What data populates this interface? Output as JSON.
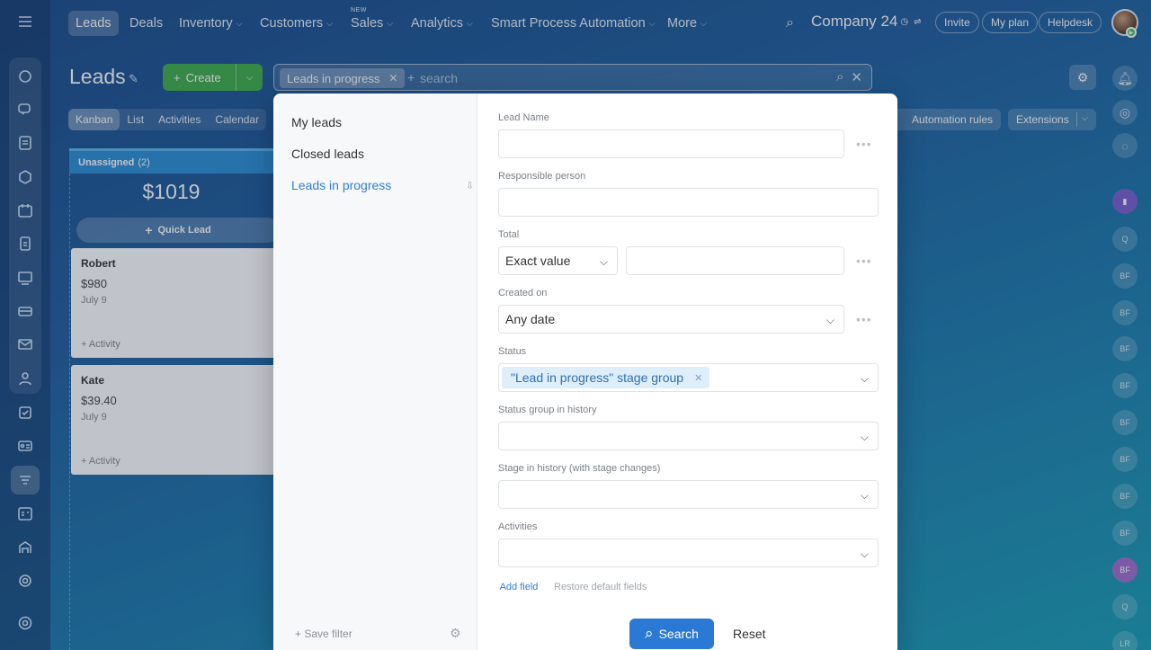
{
  "nav": {
    "items": [
      "Leads",
      "Deals",
      "Inventory",
      "Customers",
      "Sales",
      "Analytics",
      "Smart Process Automation",
      "More"
    ],
    "new_badge": "NEW",
    "company": "Company 24",
    "invite": "Invite",
    "my_plan": "My plan",
    "helpdesk": "Helpdesk"
  },
  "header": {
    "title": "Leads",
    "create_label": "Create",
    "search_chip": "Leads in progress",
    "search_placeholder": "search"
  },
  "view_tabs": [
    "Kanban",
    "List",
    "Activities",
    "Calendar"
  ],
  "toolbar": {
    "automation_rules": "Automation rules",
    "extensions": "Extensions"
  },
  "kanban": {
    "column_title": "Unassigned",
    "column_count": "(2)",
    "column_sum": "$1019",
    "quick_lead": "Quick Lead",
    "cards": [
      {
        "name": "Robert",
        "amount": "$980",
        "date": "July 9",
        "activity": "+ Activity"
      },
      {
        "name": "Kate",
        "amount": "$39.40",
        "date": "July 9",
        "activity": "+ Activity"
      }
    ]
  },
  "right_rail": {
    "avatars": [
      "Q",
      "BF",
      "BF",
      "BF",
      "BF",
      "BF",
      "BF",
      "BF",
      "BF",
      "BF",
      "Q",
      "LR"
    ]
  },
  "filter": {
    "presets": [
      "My leads",
      "Closed leads",
      "Leads in progress"
    ],
    "save_filter": "+ Save filter",
    "fields": {
      "lead_name": "Lead Name",
      "responsible": "Responsible person",
      "total": "Total",
      "total_mode": "Exact value",
      "created_on": "Created on",
      "created_value": "Any date",
      "status": "Status",
      "status_value": "\"Lead in progress\" stage group",
      "status_history": "Status group in history",
      "stage_history": "Stage in history (with stage changes)",
      "activities": "Activities"
    },
    "add_field": "Add field",
    "restore": "Restore default fields",
    "search_button": "Search",
    "reset_button": "Reset"
  }
}
